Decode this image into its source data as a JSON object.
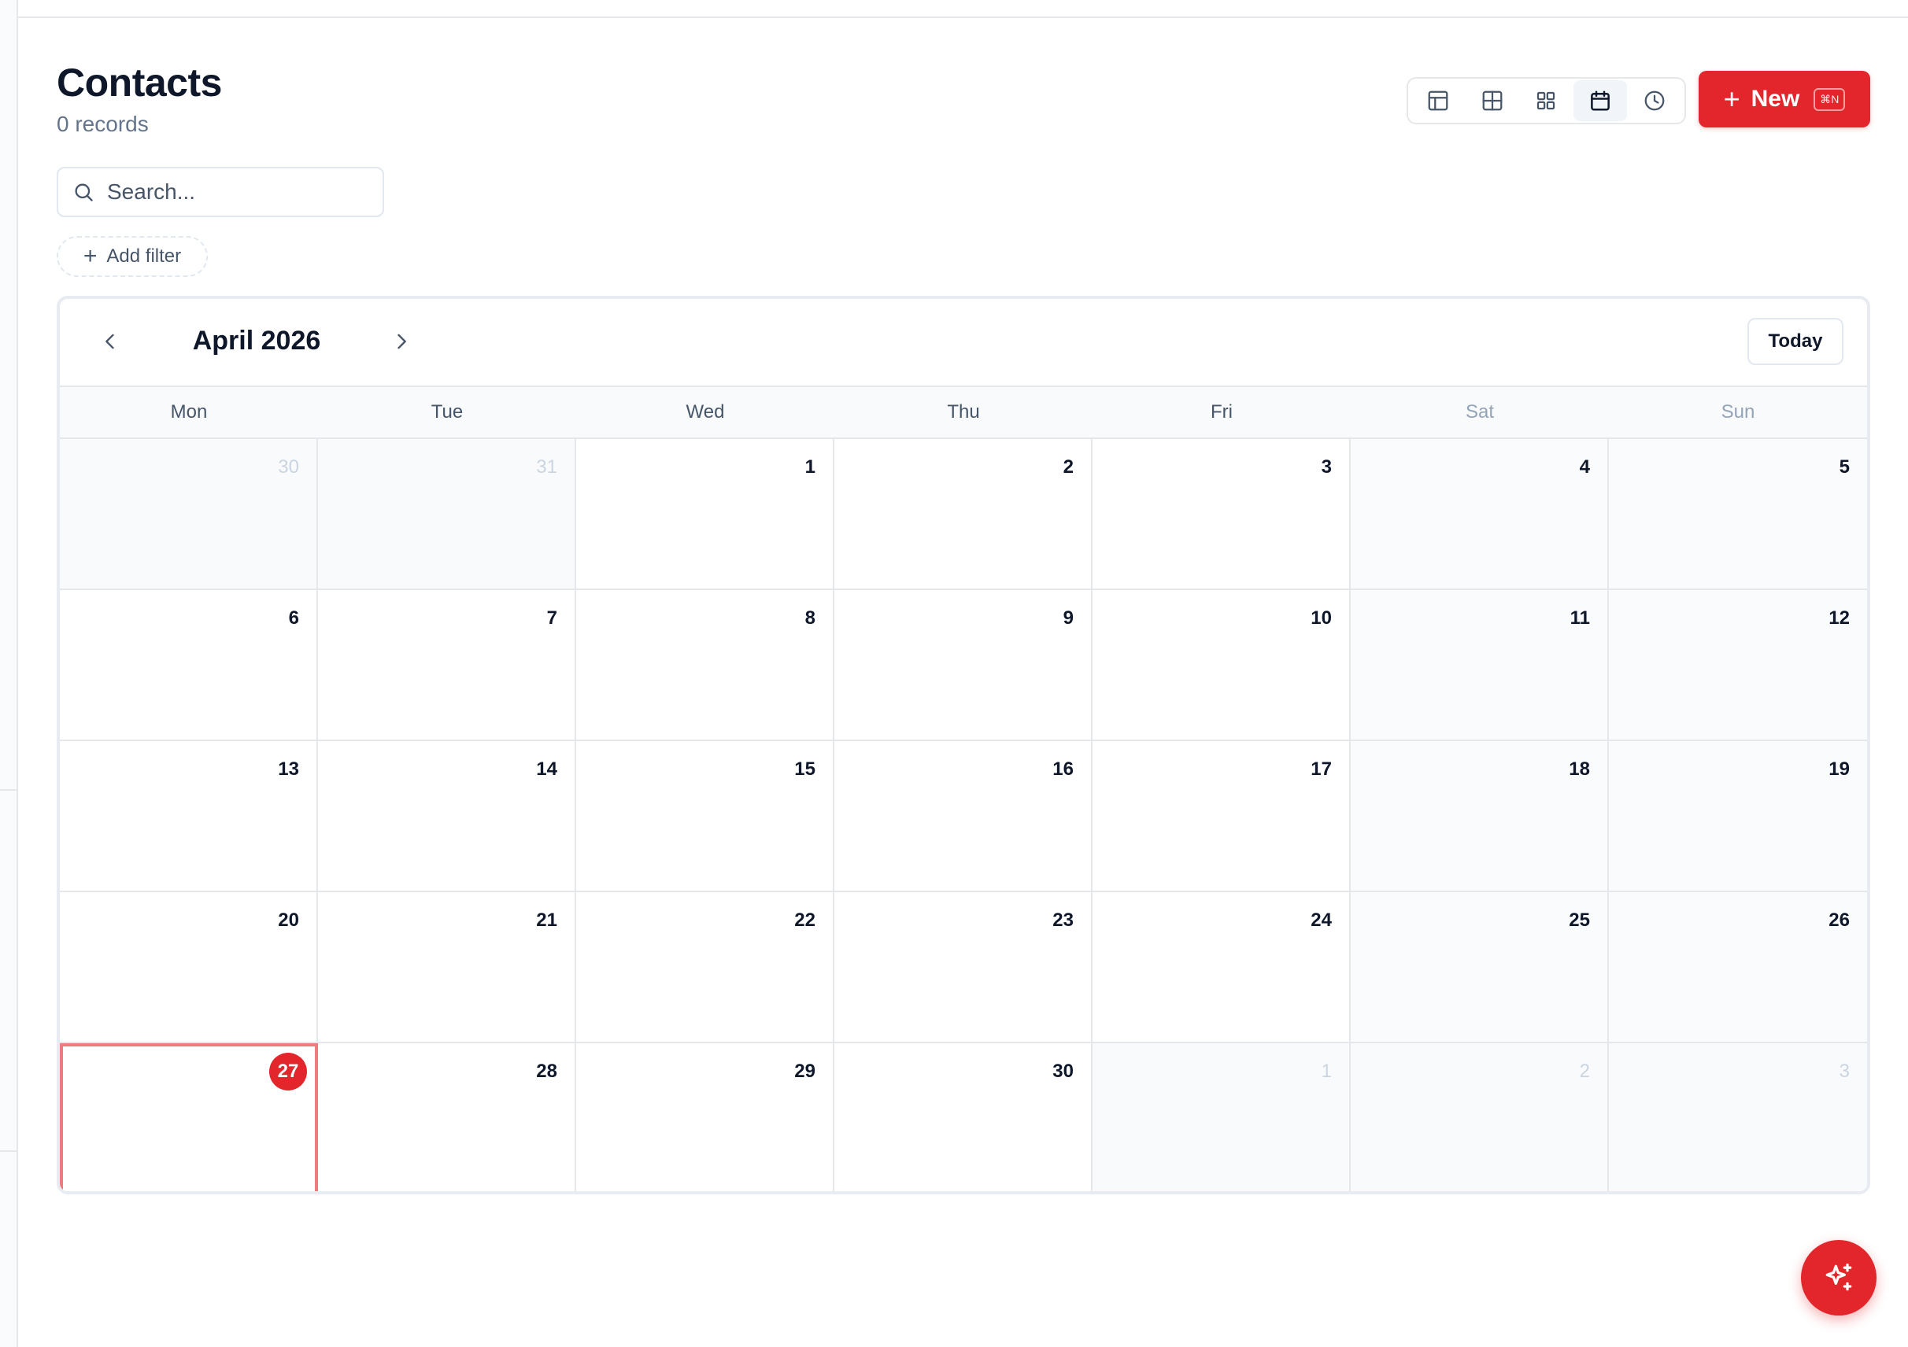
{
  "header": {
    "title": "Contacts",
    "record_count": "0 records"
  },
  "views": [
    {
      "name": "table-view-icon",
      "active": false
    },
    {
      "name": "grid-view-icon",
      "active": false
    },
    {
      "name": "gallery-view-icon",
      "active": false
    },
    {
      "name": "calendar-view-icon",
      "active": true
    },
    {
      "name": "timeline-view-icon",
      "active": false
    }
  ],
  "new_button": {
    "label": "New",
    "shortcut": "⌘N"
  },
  "search": {
    "placeholder": "Search..."
  },
  "filter": {
    "add_label": "Add filter"
  },
  "calendar": {
    "month_label": "April 2026",
    "today_label": "Today",
    "weekdays": [
      "Mon",
      "Tue",
      "Wed",
      "Thu",
      "Fri",
      "Sat",
      "Sun"
    ],
    "today_date": "27",
    "days": [
      {
        "n": "30",
        "outside": true
      },
      {
        "n": "31",
        "outside": true
      },
      {
        "n": "1"
      },
      {
        "n": "2"
      },
      {
        "n": "3"
      },
      {
        "n": "4"
      },
      {
        "n": "5"
      },
      {
        "n": "6"
      },
      {
        "n": "7"
      },
      {
        "n": "8"
      },
      {
        "n": "9"
      },
      {
        "n": "10"
      },
      {
        "n": "11"
      },
      {
        "n": "12"
      },
      {
        "n": "13"
      },
      {
        "n": "14"
      },
      {
        "n": "15"
      },
      {
        "n": "16"
      },
      {
        "n": "17"
      },
      {
        "n": "18"
      },
      {
        "n": "19"
      },
      {
        "n": "20"
      },
      {
        "n": "21"
      },
      {
        "n": "22"
      },
      {
        "n": "23"
      },
      {
        "n": "24"
      },
      {
        "n": "25"
      },
      {
        "n": "26"
      },
      {
        "n": "27",
        "today": true
      },
      {
        "n": "28"
      },
      {
        "n": "29"
      },
      {
        "n": "30"
      },
      {
        "n": "1",
        "outside": true
      },
      {
        "n": "2",
        "outside": true
      },
      {
        "n": "3",
        "outside": true
      }
    ]
  },
  "fab": {
    "icon": "sparkles-icon"
  },
  "colors": {
    "accent": "#e3262b",
    "today_outline": "#ef7b7e",
    "text": "#0f172a",
    "muted": "#64748b"
  }
}
